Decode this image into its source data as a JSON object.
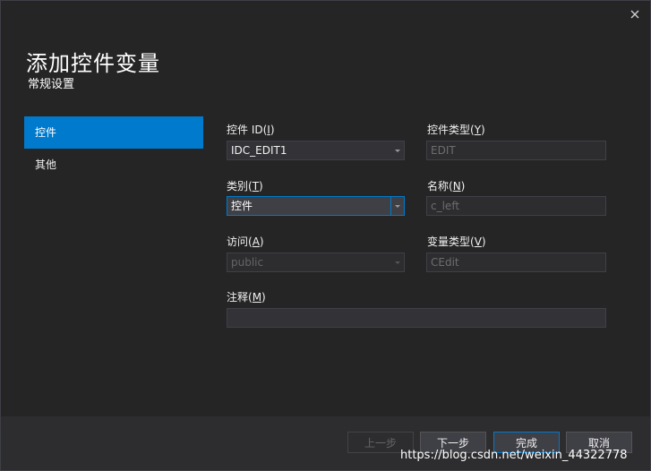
{
  "dialog": {
    "title": "添加控件变量",
    "subtitle": "常规设置",
    "close_glyph": "✕"
  },
  "nav": {
    "items": [
      {
        "label": "控件",
        "active": true
      },
      {
        "label": "其他",
        "active": false
      }
    ]
  },
  "form": {
    "control_id": {
      "label_text": "控件 ID(",
      "accel": "I",
      "label_end": ")",
      "value": "IDC_EDIT1"
    },
    "control_type": {
      "label_text": "控件类型(",
      "accel": "Y",
      "label_end": ")",
      "value": "EDIT"
    },
    "category": {
      "label_text": "类别(",
      "accel": "T",
      "label_end": ")",
      "value": "控件"
    },
    "name": {
      "label_text": "名称(",
      "accel": "N",
      "label_end": ")",
      "value": "c_left"
    },
    "access": {
      "label_text": "访问(",
      "accel": "A",
      "label_end": ")",
      "value": "public"
    },
    "var_type": {
      "label_text": "变量类型(",
      "accel": "V",
      "label_end": ")",
      "value": "CEdit"
    },
    "comment": {
      "label_text": "注释(",
      "accel": "M",
      "label_end": ")",
      "value": ""
    }
  },
  "buttons": {
    "prev": "上一步",
    "next": "下一步",
    "finish": "完成",
    "cancel": "取消"
  },
  "watermark": "https://blog.csdn.net/weixin_44322778",
  "colors": {
    "background": "#252526",
    "accent": "#007acc",
    "footer": "#2d2d30"
  },
  "icons": [
    "close-icon",
    "dropdown-arrow-icon"
  ]
}
